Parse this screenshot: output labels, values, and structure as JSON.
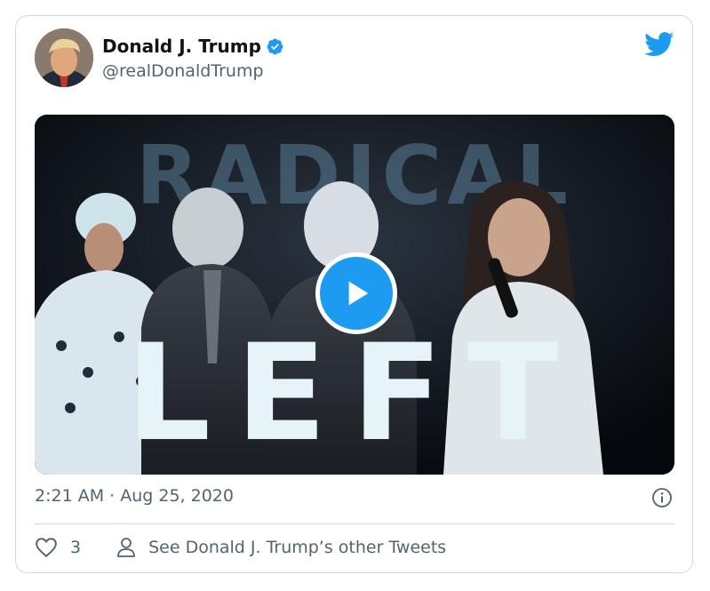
{
  "tweet": {
    "author_name": "Donald J. Trump",
    "handle": "@realDonaldTrump",
    "timestamp": "2:21 AM · Aug 25, 2020",
    "like_count": "3",
    "other_tweets_label": "See Donald J. Trump’s other Tweets"
  },
  "media": {
    "headline_top": "RADICAL",
    "headline_bottom": "LEFT"
  },
  "icons": {
    "verified": "verified-badge-icon",
    "brand": "twitter-bird-icon",
    "play": "play-icon",
    "info": "info-icon",
    "like": "heart-icon",
    "profile": "person-icon"
  },
  "colors": {
    "accent": "#1d9bf0",
    "text": "#0f1419",
    "secondary": "#536471",
    "border": "#cfd9de"
  }
}
